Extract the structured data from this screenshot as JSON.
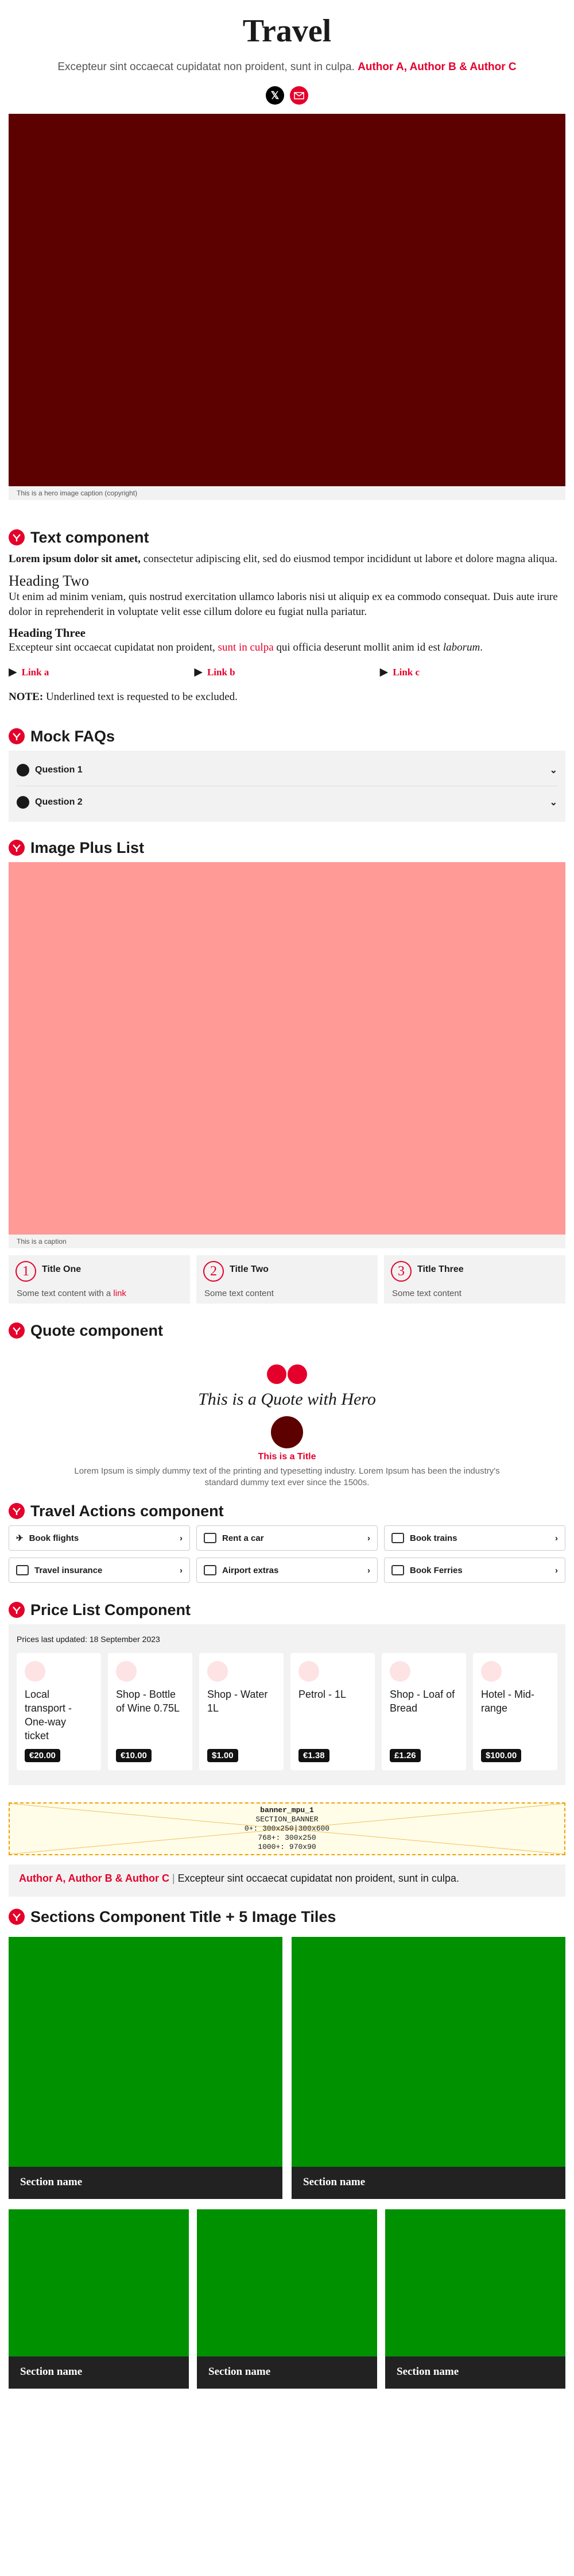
{
  "header": {
    "title": "Travel",
    "subtitle_text": "Excepteur sint occaecat cupidatat non proident, sunt in culpa.",
    "authors": "Author A, Author B & Author C",
    "social_x": "𝕏"
  },
  "hero": {
    "caption": "This is a hero image caption (copyright)"
  },
  "text_component": {
    "heading": "Text component",
    "p1_bold": "Lorem ipsum dolor sit amet,",
    "p1_rest": " consectetur adipiscing elit, sed do eiusmod tempor incididunt ut labore et dolore magna aliqua.",
    "h2": "Heading Two",
    "p2": "Ut enim ad minim veniam, quis nostrud exercitation ullamco laboris nisi ut aliquip ex ea commodo consequat. Duis aute irure dolor in reprehenderit in voluptate velit esse cillum dolore eu fugiat nulla pariatur.",
    "h3": "Heading Three",
    "p3_a": "Excepteur sint occaecat cupidatat non proident, ",
    "p3_link": "sunt in culpa",
    "p3_b": " qui officia deserunt mollit anim id est ",
    "p3_italic": "laborum",
    "p3_end": ".",
    "links": [
      "Link a",
      "Link b",
      "Link c"
    ],
    "note_bold": "NOTE:",
    "note_rest": " Underlined text is requested to be excluded."
  },
  "faqs": {
    "heading": "Mock FAQs",
    "items": [
      "Question 1",
      "Question 2"
    ]
  },
  "image_plus_list": {
    "heading": "Image Plus List",
    "caption": "This is a caption",
    "items": [
      {
        "num": "1",
        "title": "Title One",
        "text": "Some text content with a ",
        "link": "link"
      },
      {
        "num": "2",
        "title": "Title Two",
        "text": "Some text content",
        "link": ""
      },
      {
        "num": "3",
        "title": "Title Three",
        "text": "Some text content",
        "link": ""
      }
    ]
  },
  "quote": {
    "heading": "Quote component",
    "text": "This is a Quote with Hero",
    "name": "This is a Title",
    "desc": "Lorem Ipsum is simply dummy text of the printing and typesetting industry. Lorem Ipsum has been the industry's standard dummy text ever since the 1500s."
  },
  "travel_actions": {
    "heading": "Travel Actions component",
    "items": [
      "Book flights",
      "Rent a car",
      "Book trains",
      "Travel insurance",
      "Airport extras",
      "Book Ferries"
    ]
  },
  "price_list": {
    "heading": "Price List Component",
    "updated": "Prices last updated: 18 September 2023",
    "items": [
      {
        "name": "Local transport - One-way ticket",
        "price": "€20.00"
      },
      {
        "name": "Shop - Bottle of Wine 0.75L",
        "price": "€10.00"
      },
      {
        "name": "Shop - Water 1L",
        "price": "$1.00"
      },
      {
        "name": "Petrol - 1L",
        "price": "€1.38"
      },
      {
        "name": "Shop - Loaf of Bread",
        "price": "£1.26"
      },
      {
        "name": "Hotel - Mid-range",
        "price": "$100.00"
      }
    ]
  },
  "banner": {
    "line1": "banner_mpu_1",
    "line2": "SECTION_BANNER",
    "line3": "0+: 300x250|300x600",
    "line4": "768+: 300x250",
    "line5": "1000+: 970x90"
  },
  "byline": {
    "authors": "Author A, Author B & Author C",
    "sep": " | ",
    "text": "Excepteur sint occaecat cupidatat non proident, sunt in culpa."
  },
  "sections": {
    "heading": "Sections Component Title + 5 Image Tiles",
    "tiles": [
      "Section name",
      "Section name",
      "Section name",
      "Section name",
      "Section name"
    ]
  }
}
